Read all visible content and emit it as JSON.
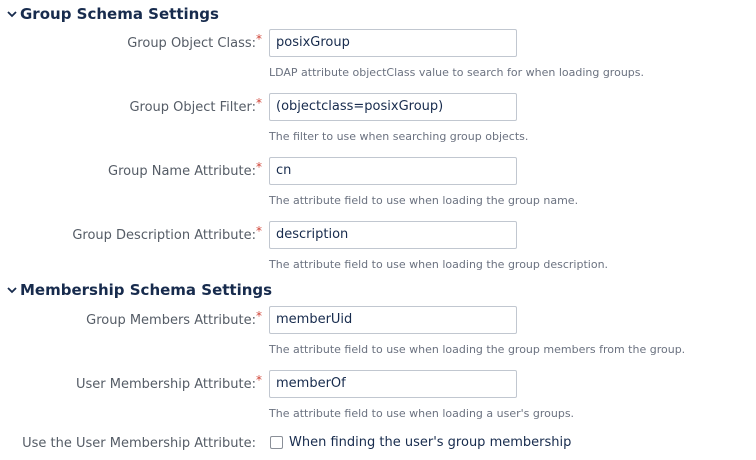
{
  "sections": {
    "group_schema": {
      "title": "Group Schema Settings",
      "icon": "chevron-down-icon",
      "fields": [
        {
          "label": "Group Object Class:",
          "required_marker": "*",
          "value": "posixGroup",
          "description": "LDAP attribute objectClass value to search for when loading groups."
        },
        {
          "label": "Group Object Filter:",
          "required_marker": "*",
          "value": "(objectclass=posixGroup)",
          "description": "The filter to use when searching group objects."
        },
        {
          "label": "Group Name Attribute:",
          "required_marker": "*",
          "value": "cn",
          "description": "The attribute field to use when loading the group name."
        },
        {
          "label": "Group Description Attribute:",
          "required_marker": "*",
          "value": "description",
          "description": "The attribute field to use when loading the group description."
        }
      ]
    },
    "membership_schema": {
      "title": "Membership Schema Settings",
      "icon": "chevron-down-icon",
      "fields": [
        {
          "label": "Group Members Attribute:",
          "required_marker": "*",
          "value": "memberUid",
          "description": "The attribute field to use when loading the group members from the group."
        },
        {
          "label": "User Membership Attribute:",
          "required_marker": "*",
          "value": "memberOf",
          "description": "The attribute field to use when loading a user's groups."
        }
      ],
      "checkbox": {
        "label": "Use the User Membership Attribute:",
        "text": "When finding the user's group membership",
        "checked": false
      }
    }
  },
  "colors": {
    "required": "#d04437",
    "heading": "#172b4d",
    "label": "#555c66",
    "description": "#6b7280",
    "input_border": "#c1c7d0"
  }
}
